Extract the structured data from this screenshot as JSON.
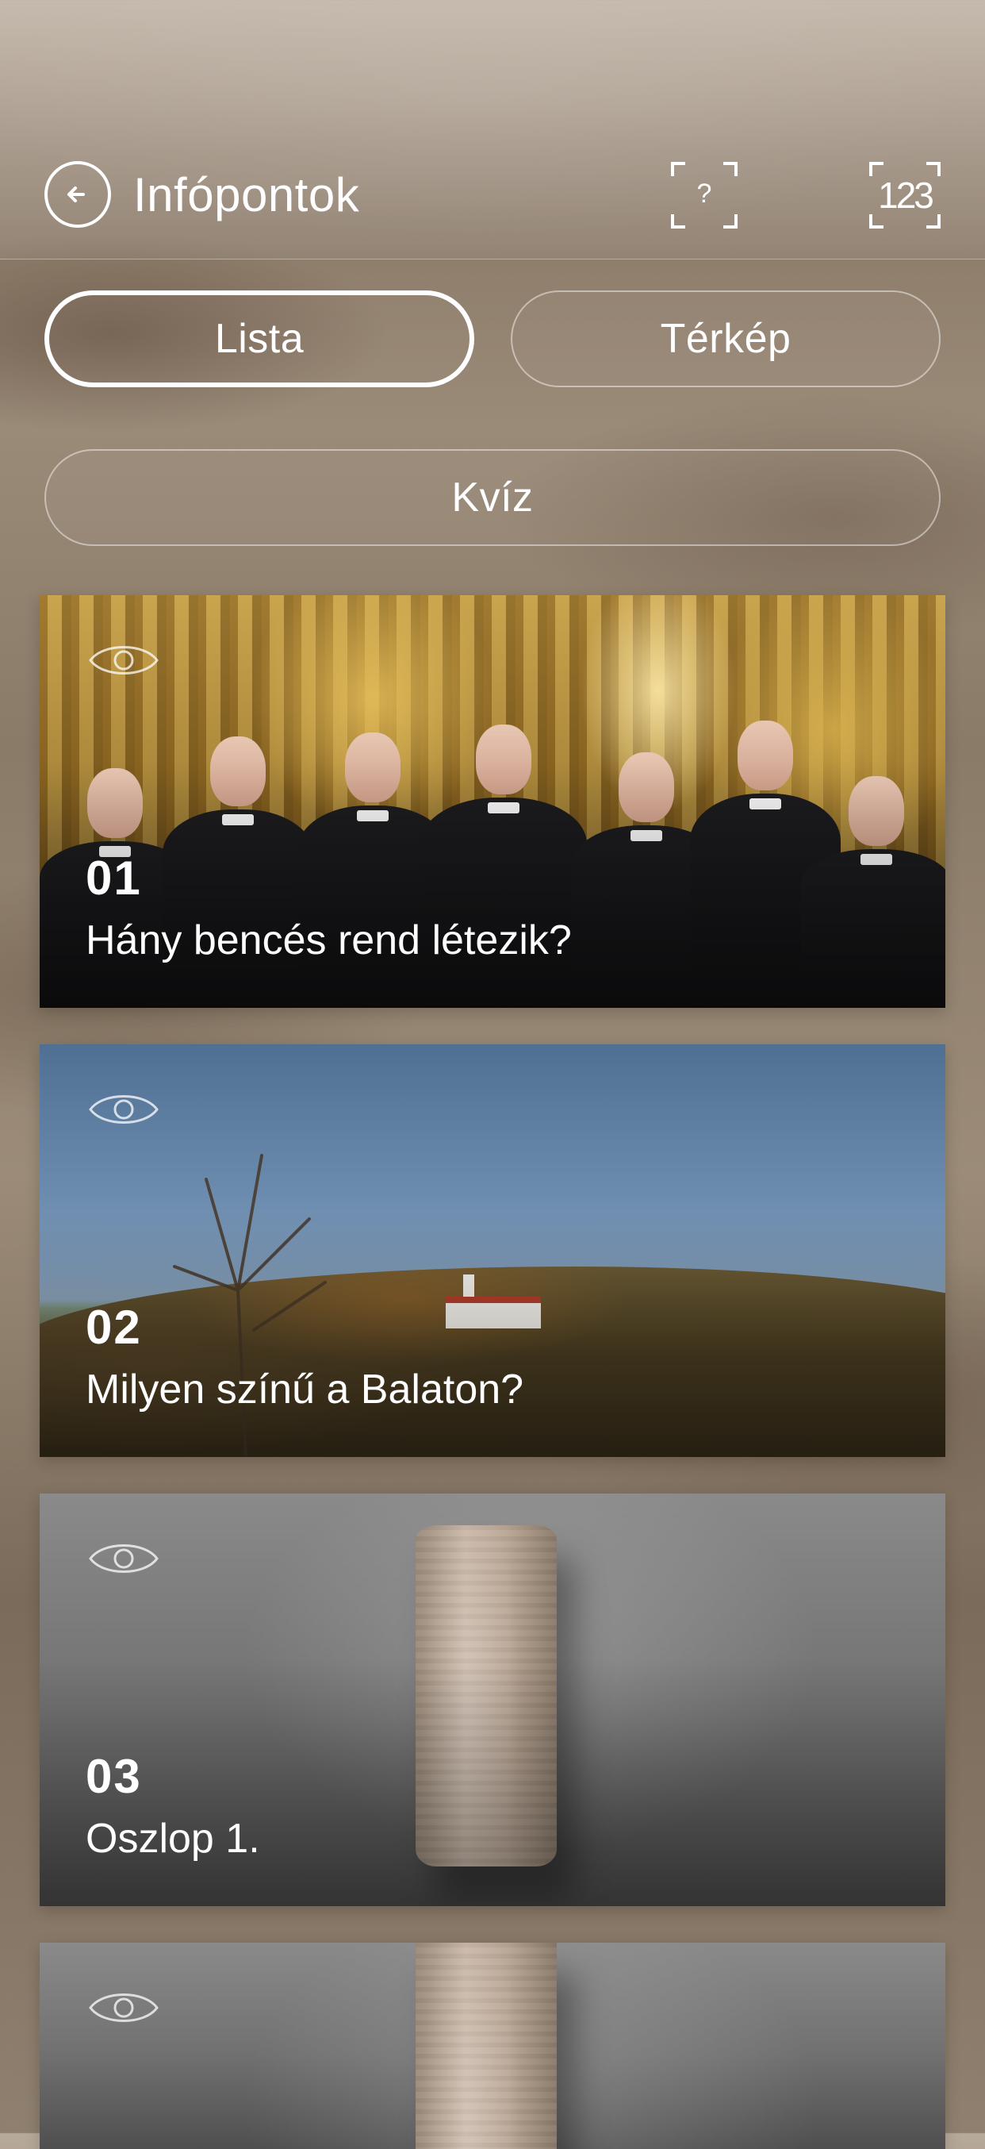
{
  "header": {
    "back_icon": "arrow-left-circle-icon",
    "title": "Infópontok",
    "help_label": "?",
    "help_icon": "scan-frame-icon",
    "numeric_label": "123",
    "numeric_icon": "scan-frame-icon"
  },
  "tabs": [
    {
      "label": "Lista",
      "active": true
    },
    {
      "label": "Térkép",
      "active": false
    }
  ],
  "quiz": {
    "label": "Kvíz"
  },
  "cards": [
    {
      "number": "01",
      "title": "Hány bencés rend létezik?",
      "visited_icon": "eye-icon"
    },
    {
      "number": "02",
      "title": "Milyen színű a Balaton?",
      "visited_icon": "eye-icon"
    },
    {
      "number": "03",
      "title": "Oszlop 1.",
      "visited_icon": "eye-icon"
    },
    {
      "number": "",
      "title": "",
      "visited_icon": "eye-icon"
    }
  ],
  "colors": {
    "text": "#ffffff",
    "accent_gold": "#b89240",
    "sky": "#6d8db0",
    "stone": "#c8b6a6"
  }
}
